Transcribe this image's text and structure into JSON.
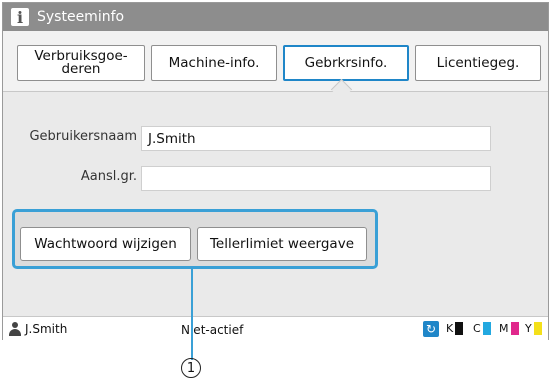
{
  "window": {
    "title": "Systeeminfo",
    "icon": "info-icon"
  },
  "tabs": [
    {
      "label": "Verbruiksgoe-\nderen",
      "selected": false
    },
    {
      "label": "Machine-info.",
      "selected": false
    },
    {
      "label": "Gebrkrsinfo.",
      "selected": true
    },
    {
      "label": "Licentiegeg.",
      "selected": false
    }
  ],
  "fields": {
    "username_label": "Gebruikersnaam",
    "username_value": "J.Smith",
    "group_label": "Aansl.gr.",
    "group_value": ""
  },
  "buttons": {
    "change_password": "Wachtwoord wijzigen",
    "counter_limit": "Tellerlimiet weergave"
  },
  "status": {
    "user": "J.Smith",
    "state": "Niet-actief",
    "inks": [
      {
        "letter": "K",
        "color": "#111111"
      },
      {
        "letter": "C",
        "color": "#22a8e0"
      },
      {
        "letter": "M",
        "color": "#e0288c"
      },
      {
        "letter": "Y",
        "color": "#f4e01a"
      }
    ]
  },
  "callout": {
    "number": "1"
  },
  "colors": {
    "accent": "#1f86c8",
    "highlight": "#3aa0d6",
    "titlebar": "#8d8d8d"
  }
}
